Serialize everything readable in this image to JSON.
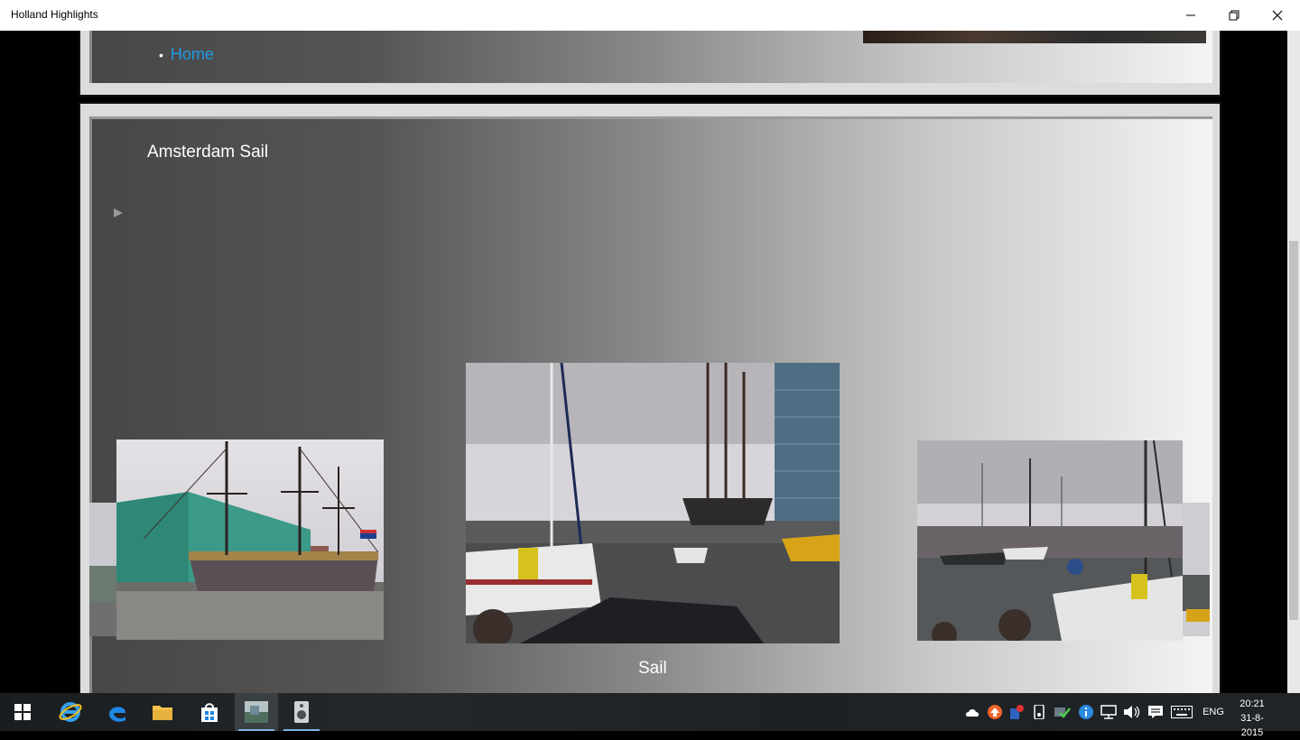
{
  "window": {
    "title": "Holland Highlights"
  },
  "nav": {
    "home_label": "Home"
  },
  "section": {
    "title": "Amsterdam Sail",
    "caption": "Sail"
  },
  "taskbar": {
    "language": "ENG",
    "time": "20:21",
    "date": "31-8-2015",
    "pinned": [
      "start-icon",
      "internet-explorer-icon",
      "edge-icon",
      "file-explorer-icon",
      "store-icon",
      "photos-app-icon",
      "speaker-app-icon"
    ]
  },
  "colors": {
    "link": "#1e9be0",
    "accent_underline": "#7fb3e6"
  }
}
